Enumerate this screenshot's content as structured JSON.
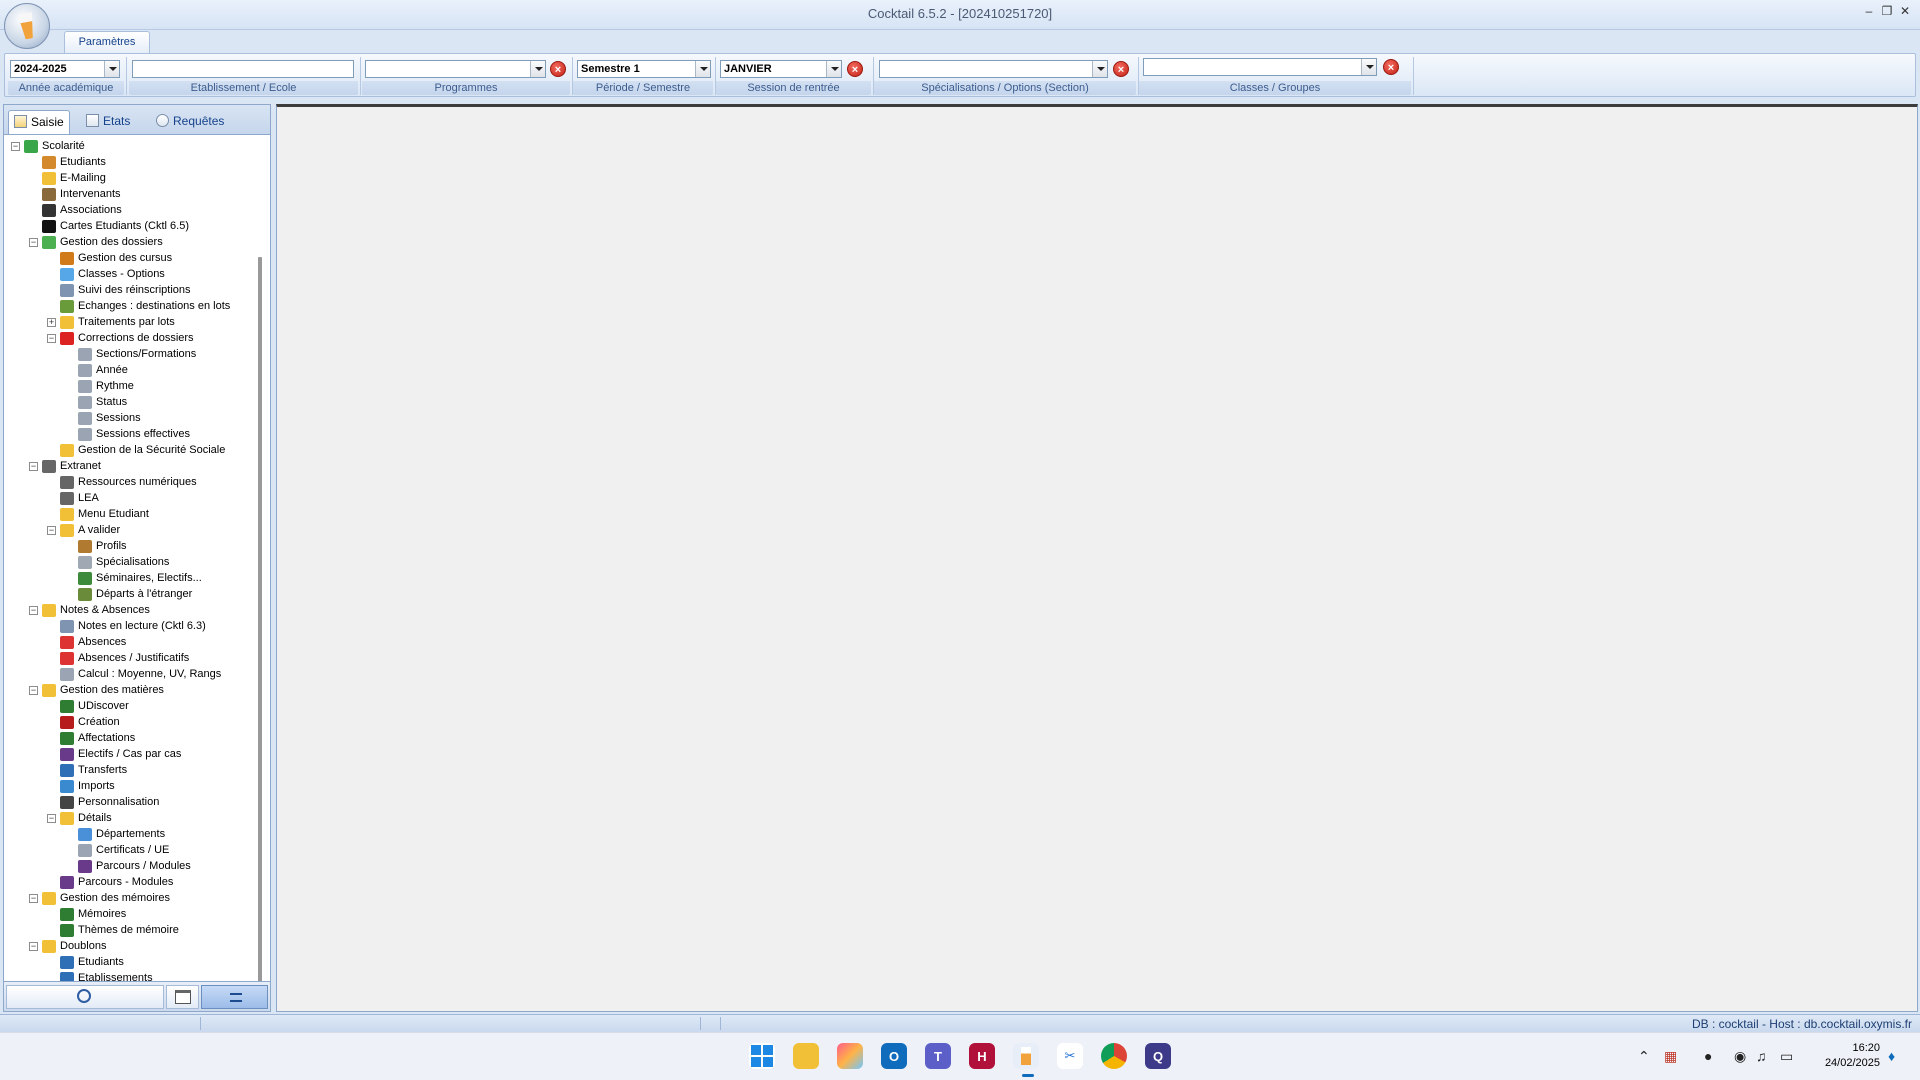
{
  "window": {
    "title": "Cocktail 6.5.2 -   [202410251720]"
  },
  "ribbon": {
    "tab_label": "Paramètres",
    "groups": [
      {
        "label": "Année académique",
        "value": "2024-2025"
      },
      {
        "label": "Etablissement / Ecole",
        "value": ""
      },
      {
        "label": "Programmes",
        "value": ""
      },
      {
        "label": "Période / Semestre",
        "value": "Semestre 1"
      },
      {
        "label": "Session de rentrée",
        "value": "JANVIER"
      },
      {
        "label": "Spécialisations / Options (Section)",
        "value": ""
      },
      {
        "label": "Classes / Groupes",
        "value": ""
      }
    ]
  },
  "left_panel": {
    "tabs": [
      "Saisie",
      "Etats",
      "Requêtes"
    ],
    "tree": [
      "Scolarité",
      "Etudiants",
      "E-Mailing",
      "Intervenants",
      "Associations",
      "Cartes Etudiants (Cktl 6.5)",
      "Gestion des dossiers",
      "Gestion des cursus",
      "Classes - Options",
      "Suivi des réinscriptions",
      "Echanges : destinations en lots",
      "Traitements par lots",
      "Corrections de dossiers",
      "Sections/Formations",
      "Année",
      "Rythme",
      "Status",
      "Sessions",
      "Sessions effectives",
      "Gestion de la Sécurité Sociale",
      "Extranet",
      "Ressources numériques",
      "LEA",
      "Menu Etudiant",
      "A valider",
      "Profils",
      "Spécialisations",
      "Séminaires, Electifs...",
      "Départs à l'étranger",
      "Notes & Absences",
      "Notes en lecture (Cktl 6.3)",
      "Absences",
      "Absences / Justificatifs",
      "Calcul : Moyenne, UV, Rangs",
      "Gestion des matières",
      "UDiscover",
      "Création",
      "Affectations",
      "Electifs / Cas par cas",
      "Transferts",
      "Imports",
      "Personnalisation",
      "Détails",
      "Départements",
      "Certificats / UE",
      "Parcours / Modules",
      "Parcours - Modules",
      "Gestion des mémoires",
      "Mémoires",
      "Thèmes de mémoire",
      "Doublons",
      "Etudiants",
      "Etablissements"
    ]
  },
  "statusbar": {
    "db_info": "DB : cocktail - Host : db.cocktail.oxymis.fr"
  },
  "taskbar": {
    "time": "16:20",
    "date": "24/02/2025"
  }
}
